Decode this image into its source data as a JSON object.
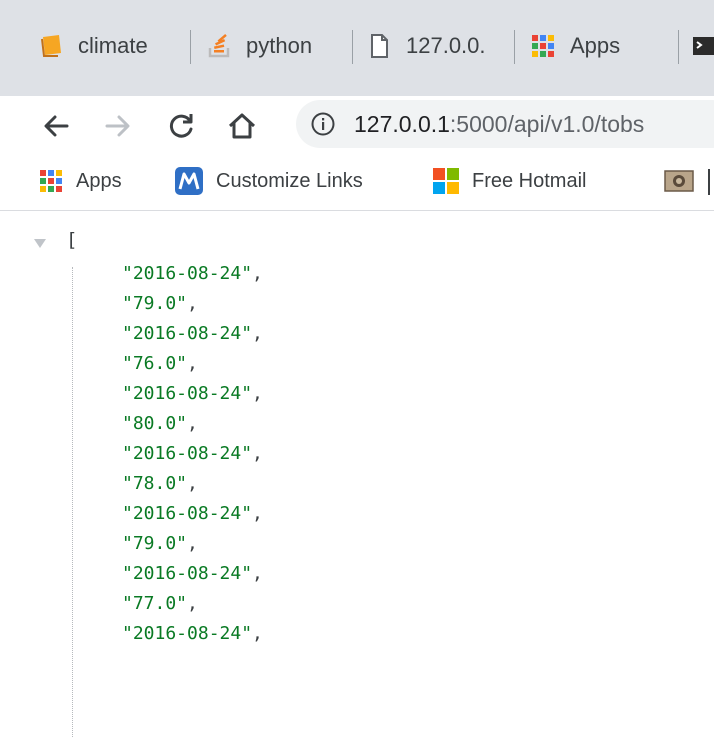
{
  "tabs": [
    {
      "label": "climate",
      "icon": "notebook-icon",
      "color": "#f6a623"
    },
    {
      "label": "python",
      "icon": "stack-icon",
      "color": "#f48024"
    },
    {
      "label": "127.0.0.",
      "icon": "page-icon",
      "color": "#5f6368"
    },
    {
      "label": "Apps",
      "icon": "apps-grid-icon",
      "color": "#4285f4"
    },
    {
      "label": "",
      "icon": "terminal-icon",
      "color": "#2b2b2b"
    }
  ],
  "toolbar": {
    "back_icon": "back-arrow-icon",
    "forward_icon": "forward-arrow-icon",
    "reload_icon": "reload-icon",
    "home_icon": "home-icon",
    "url_host": "127.0.0.1",
    "url_path": ":5000/api/v1.0/tobs"
  },
  "bookmarks": [
    {
      "label": "Apps",
      "icon": "apps-grid-icon"
    },
    {
      "label": "Customize Links",
      "icon": "m-logo-icon",
      "color": "#2f6fc5"
    },
    {
      "label": "Free Hotmail",
      "icon": "windows-logo-icon"
    },
    {
      "label": "",
      "icon": "photo-icon"
    }
  ],
  "json_viewer": {
    "open_bracket": "[",
    "items": [
      "\"2016-08-24\"",
      "\"79.0\"",
      "\"2016-08-24\"",
      "\"76.0\"",
      "\"2016-08-24\"",
      "\"80.0\"",
      "\"2016-08-24\"",
      "\"78.0\"",
      "\"2016-08-24\"",
      "\"79.0\"",
      "\"2016-08-24\"",
      "\"77.0\"",
      "\"2016-08-24\""
    ],
    "separator": ","
  }
}
